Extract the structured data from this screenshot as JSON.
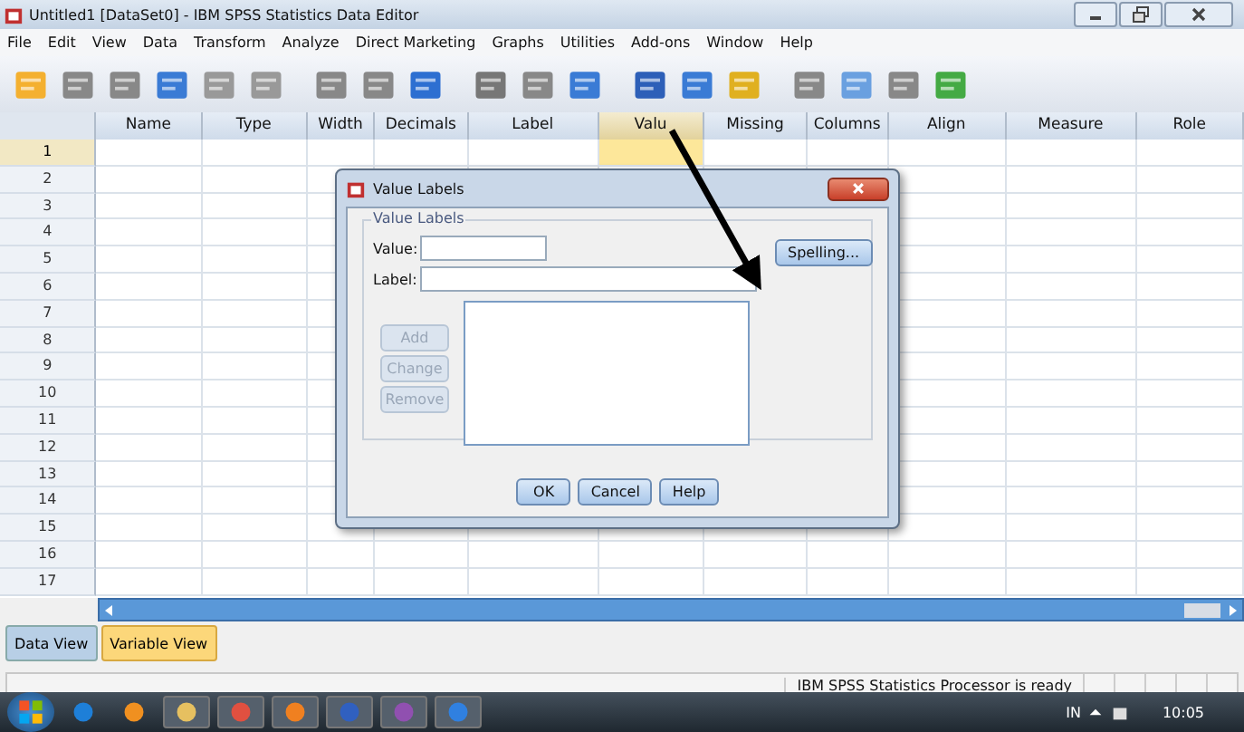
{
  "window": {
    "title": "Untitled1 [DataSet0] - IBM SPSS Statistics Data Editor"
  },
  "menu": [
    "File",
    "Edit",
    "View",
    "Data",
    "Transform",
    "Analyze",
    "Direct Marketing",
    "Graphs",
    "Utilities",
    "Add-ons",
    "Window",
    "Help"
  ],
  "table": {
    "columns": [
      {
        "label": "Name",
        "selected": false
      },
      {
        "label": "Type",
        "selected": false
      },
      {
        "label": "Width",
        "selected": false
      },
      {
        "label": "Decimals",
        "selected": false
      },
      {
        "label": "Label",
        "selected": false
      },
      {
        "label": "Valu",
        "selected": true
      },
      {
        "label": "Missing",
        "selected": false
      },
      {
        "label": "Columns",
        "selected": false
      },
      {
        "label": "Align",
        "selected": false
      },
      {
        "label": "Measure",
        "selected": false
      },
      {
        "label": "Role",
        "selected": false
      }
    ],
    "rows": [
      {
        "number": "1",
        "selected": true
      },
      {
        "number": "2",
        "selected": false
      },
      {
        "number": "3",
        "selected": false
      },
      {
        "number": "4",
        "selected": false
      },
      {
        "number": "5",
        "selected": false
      },
      {
        "number": "6",
        "selected": false
      },
      {
        "number": "7",
        "selected": false
      },
      {
        "number": "8",
        "selected": false
      },
      {
        "number": "9",
        "selected": false
      },
      {
        "number": "10",
        "selected": false
      },
      {
        "number": "11",
        "selected": false
      },
      {
        "number": "12",
        "selected": false
      },
      {
        "number": "13",
        "selected": false
      },
      {
        "number": "14",
        "selected": false
      },
      {
        "number": "15",
        "selected": false
      },
      {
        "number": "16",
        "selected": false
      },
      {
        "number": "17",
        "selected": false
      }
    ]
  },
  "tabs": [
    {
      "label": "Data View",
      "selected": false
    },
    {
      "label": "Variable View",
      "selected": true
    }
  ],
  "status_bar": {
    "text": "IBM SPSS Statistics Processor is ready"
  },
  "dialog": {
    "title": "Value Labels",
    "group": "Value Labels",
    "fields": [
      {
        "label": "Value:",
        "kind": "short"
      },
      {
        "label": "Label:",
        "kind": "long"
      }
    ],
    "spelling_button": "Spelling...",
    "side_buttons": [
      {
        "label": "Add",
        "disabled": true
      },
      {
        "label": "Change",
        "disabled": true
      },
      {
        "label": "Remove",
        "disabled": true
      }
    ],
    "buttons": [
      "OK",
      "Cancel",
      "Help"
    ]
  },
  "taskbar": {
    "language": "IN",
    "time": "10:05"
  }
}
